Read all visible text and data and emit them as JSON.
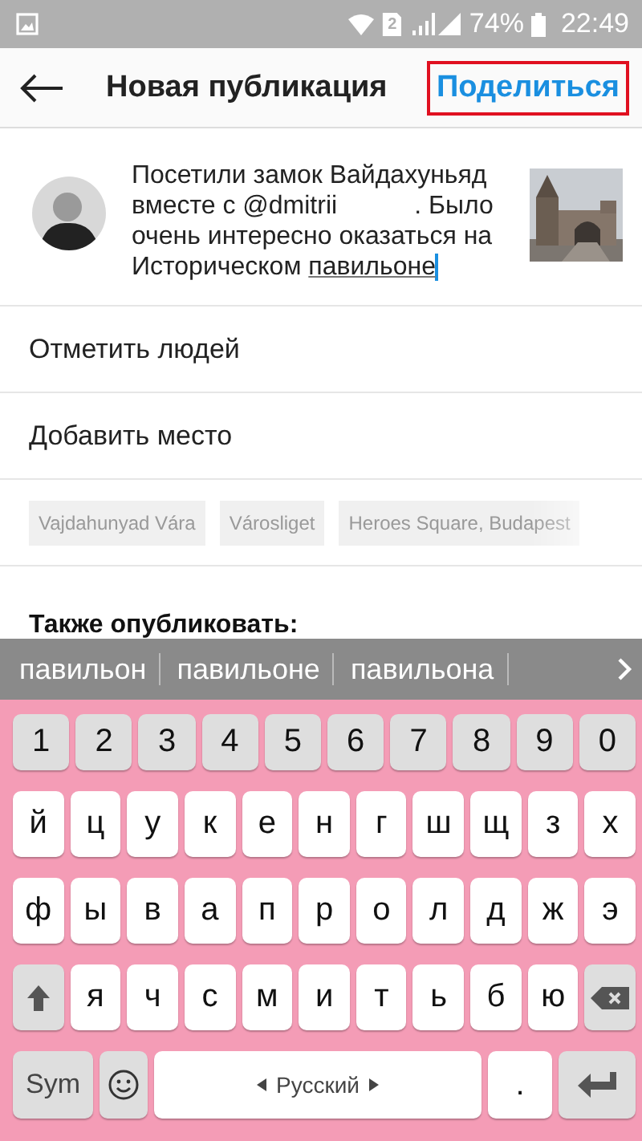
{
  "status_bar": {
    "battery": "74%",
    "time": "22:49",
    "sim": "2"
  },
  "header": {
    "title": "Новая публикация",
    "action": "Поделиться",
    "action_highlighted": true
  },
  "post": {
    "caption_start": "Посетили замок Вайдахуньяд вместе с @dmitrii",
    "caption_end": ". Было очень интересно оказаться на Историческом",
    "composing_word": "павильоне"
  },
  "options": [
    "Отметить людей",
    "Добавить место"
  ],
  "location_suggestions": [
    "Vajdahunyad Vára",
    "Városliget",
    "Heroes Square, Budapest"
  ],
  "also_publish": "Также опубликовать:",
  "keyboard": {
    "suggestions": [
      {
        "text": "павильон"
      },
      {
        "text": "павильоне"
      },
      {
        "text": "павильона"
      }
    ],
    "number_keys": [
      "1",
      "2",
      "3",
      "4",
      "5",
      "6",
      "7",
      "8",
      "9",
      "0"
    ],
    "rows": [
      [
        {
          "kind": "char",
          "label": "й"
        },
        {
          "kind": "char",
          "label": "ц"
        },
        {
          "kind": "char",
          "label": "у"
        },
        {
          "kind": "char",
          "label": "к"
        },
        {
          "kind": "char",
          "label": "е"
        },
        {
          "kind": "char",
          "label": "н"
        },
        {
          "kind": "char",
          "label": "г"
        },
        {
          "kind": "char",
          "label": "ш"
        },
        {
          "kind": "char",
          "label": "щ"
        },
        {
          "kind": "char",
          "label": "з"
        },
        {
          "kind": "char",
          "label": "х"
        }
      ],
      [
        {
          "kind": "char",
          "label": "ф"
        },
        {
          "kind": "char",
          "label": "ы"
        },
        {
          "kind": "char",
          "label": "в"
        },
        {
          "kind": "char",
          "label": "а"
        },
        {
          "kind": "char",
          "label": "п"
        },
        {
          "kind": "char",
          "label": "р"
        },
        {
          "kind": "char",
          "label": "о"
        },
        {
          "kind": "char",
          "label": "л"
        },
        {
          "kind": "char",
          "label": "д"
        },
        {
          "kind": "char",
          "label": "ж"
        },
        {
          "kind": "char",
          "label": "э"
        }
      ],
      [
        {
          "kind": "shift"
        },
        {
          "kind": "char",
          "label": "я"
        },
        {
          "kind": "char",
          "label": "ч"
        },
        {
          "kind": "char",
          "label": "с"
        },
        {
          "kind": "char",
          "label": "м"
        },
        {
          "kind": "char",
          "label": "и"
        },
        {
          "kind": "char",
          "label": "т"
        },
        {
          "kind": "char",
          "label": "ь"
        },
        {
          "kind": "char",
          "label": "б"
        },
        {
          "kind": "char",
          "label": "ю"
        },
        {
          "kind": "backspace"
        }
      ]
    ],
    "bottom_keys": [
      {
        "kind": "sym",
        "label": "Sym"
      },
      {
        "kind": "emoji"
      },
      {
        "kind": "space",
        "label": "Русский"
      },
      {
        "kind": "period",
        "label": "."
      },
      {
        "kind": "enter"
      }
    ]
  }
}
